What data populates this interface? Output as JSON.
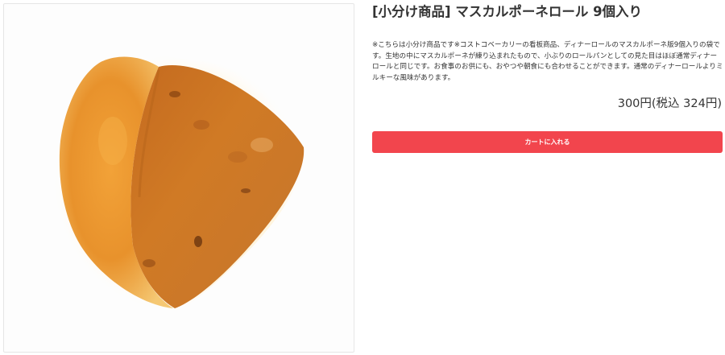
{
  "product": {
    "title": "[小分け商品] マスカルポーネロール 9個入り",
    "description": "※こちらは小分け商品です※コストコベーカリーの看板商品、ディナーロールのマスカルポーネ版9個入りの袋です。生地の中にマスカルポーネが練り込まれたもので、小ぶりのロールパンとしての見た目はほぼ通常ディナーロールと同じです。お食事のお供にも、おやつや朝食にも合わせることができます。通常のディナーロールよりミルキーな風味があります。",
    "price": "300円(税込 324円)",
    "cart_button_label": "カートに入れる",
    "image_subject": "bread-roll",
    "accent_color": "#f2454d"
  }
}
